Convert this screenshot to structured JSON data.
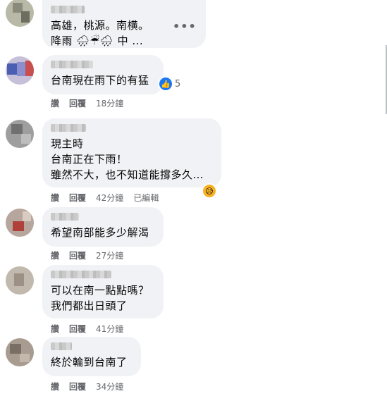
{
  "comments": [
    {
      "lines": [
        "高雄，桃源。南横。",
        "降雨 🌧☔🌧 中 ..."
      ],
      "more_label": "•••"
    },
    {
      "lines": [
        "台南現在雨下的有猛"
      ],
      "reaction_count": "5",
      "actions": {
        "like": "讚",
        "reply": "回覆",
        "time": "18分鐘"
      }
    },
    {
      "lines": [
        "現主時",
        "台南正在下雨！",
        "雖然不大，也不知道能撐多久…"
      ],
      "actions": {
        "like": "讚",
        "reply": "回覆",
        "time": "42分鐘",
        "edited": "已編輯"
      }
    },
    {
      "lines": [
        "希望南部能多少解渴"
      ],
      "actions": {
        "like": "讚",
        "reply": "回覆",
        "time": "27分鐘"
      }
    },
    {
      "lines": [
        "可以在南一點點嗎？",
        "我們都出日頭了"
      ],
      "actions": {
        "like": "讚",
        "reply": "回覆",
        "time": "41分鐘"
      }
    },
    {
      "lines": [
        "終於輪到台南了"
      ],
      "actions": {
        "like": "讚",
        "reply": "回覆",
        "time": "34分鐘"
      }
    }
  ],
  "icons": {
    "like": "thumbs-up-icon",
    "sad": "sad-face-icon",
    "more": "more-options-icon"
  },
  "colors": {
    "bubble": "#f0f2f5",
    "like_blue": "#1877f2",
    "meta_gray": "#65676b"
  }
}
